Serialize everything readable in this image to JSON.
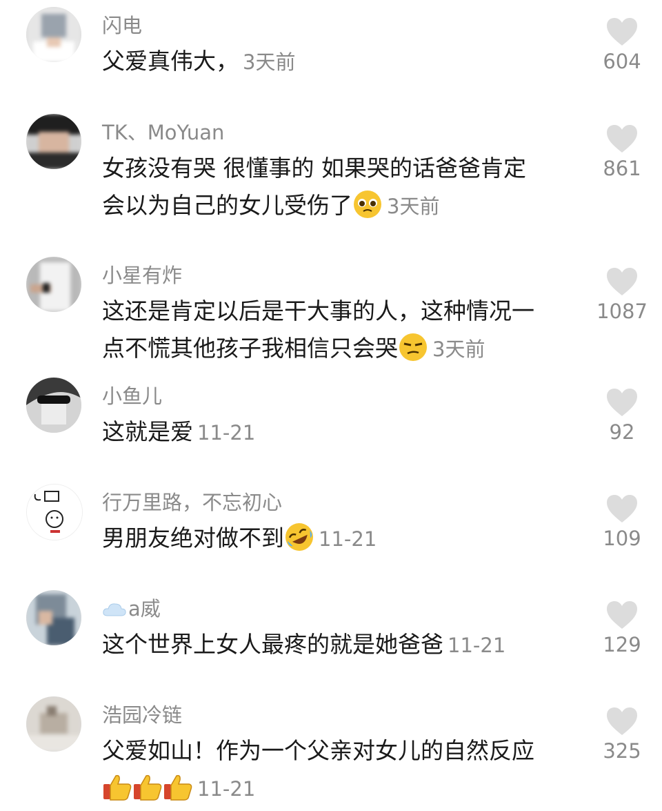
{
  "comments": [
    {
      "username": "闪电",
      "text": "父爱真伟大，",
      "time": "3天前",
      "likes": "604"
    },
    {
      "username": "TK、MoYuan",
      "text_line1": "女孩没有哭 很懂事的 如果哭的话爸爸肯定",
      "text_line2": "会以为自己的女儿受伤了",
      "emoji": "pleading-face",
      "time": "3天前",
      "likes": "861"
    },
    {
      "username": "小星有炸",
      "text_line1": "这还是肯定以后是干大事的人，这种情况一",
      "text_line2": "点不慌其他孩子我相信只会哭",
      "emoji": "smirk-face",
      "time": "3天前",
      "likes": "1087"
    },
    {
      "username": "小鱼儿",
      "text": "这就是爱",
      "time": "11-21",
      "likes": "92"
    },
    {
      "username": "行万里路，不忘初心",
      "text": "男朋友绝对做不到",
      "emoji": "rofl-face",
      "time": "11-21",
      "likes": "109"
    },
    {
      "username": "a威",
      "username_icon": "cloud-icon",
      "text": "这个世界上女人最疼的就是她爸爸",
      "time": "11-21",
      "likes": "129"
    },
    {
      "username": "浩园冷链",
      "text_line1": "父爱如山！作为一个父亲对女儿的自然反应",
      "emoji": "thumbs-up",
      "emoji_count": 3,
      "time": "11-21",
      "likes": "325"
    }
  ],
  "colors": {
    "text": "#1a1a1a",
    "meta": "#8a8a8a",
    "heart": "#dcdcdc",
    "emoji_yellow": "#f7c530"
  }
}
